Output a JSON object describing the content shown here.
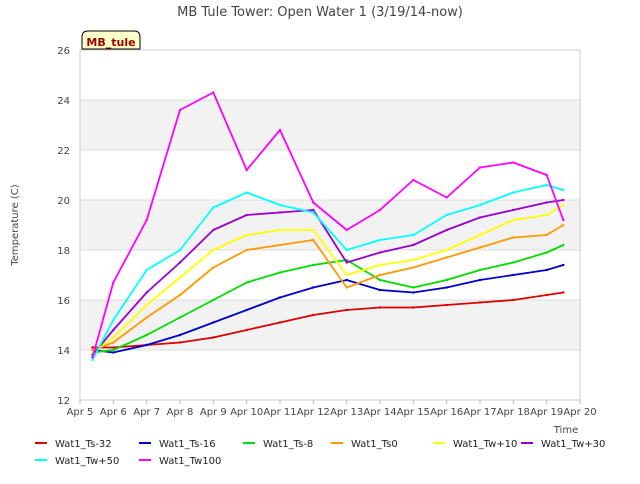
{
  "chart_data": {
    "type": "line",
    "title": "MB Tule Tower: Open Water 1 (3/19/14-now)",
    "xlabel": "Time",
    "ylabel": "Temperature (C)",
    "station_tag": "MB_tule",
    "ylim": [
      12,
      26
    ],
    "xlim": [
      "2014-04-05",
      "2014-04-20"
    ],
    "yticks": [
      "12",
      "14",
      "16",
      "18",
      "20",
      "22",
      "24",
      "26"
    ],
    "xticks": [
      "Apr 5",
      "Apr 6",
      "Apr 7",
      "Apr 8",
      "Apr 9",
      "Apr 10",
      "Apr 11",
      "Apr 12",
      "Apr 13",
      "Apr 14",
      "Apr 15",
      "Apr 16",
      "Apr 17",
      "Apr 18",
      "Apr 19",
      "Apr 20"
    ],
    "grid": true,
    "legend_position": "bottom",
    "x": [
      "2014-04-05 09:00",
      "2014-04-06 00:00",
      "2014-04-07 00:00",
      "2014-04-08 00:00",
      "2014-04-09 00:00",
      "2014-04-10 00:00",
      "2014-04-11 00:00",
      "2014-04-12 00:00",
      "2014-04-13 00:00",
      "2014-04-14 00:00",
      "2014-04-15 00:00",
      "2014-04-16 00:00",
      "2014-04-17 00:00",
      "2014-04-18 00:00",
      "2014-04-19 00:00",
      "2014-04-19 12:00"
    ],
    "series": [
      {
        "name": "Wat1_Ts-32",
        "color": "#dd0000",
        "values": [
          14.1,
          14.1,
          14.2,
          14.3,
          14.5,
          14.8,
          15.1,
          15.4,
          15.6,
          15.7,
          15.7,
          15.8,
          15.9,
          16.0,
          16.2,
          16.3
        ]
      },
      {
        "name": "Wat1_Ts-16",
        "color": "#0000cc",
        "values": [
          14.0,
          13.9,
          14.2,
          14.6,
          15.1,
          15.6,
          16.1,
          16.5,
          16.8,
          16.4,
          16.3,
          16.5,
          16.8,
          17.0,
          17.2,
          17.4
        ]
      },
      {
        "name": "Wat1_Ts-8",
        "color": "#00dd00",
        "values": [
          13.9,
          14.0,
          14.6,
          15.3,
          16.0,
          16.7,
          17.1,
          17.4,
          17.6,
          16.8,
          16.5,
          16.8,
          17.2,
          17.5,
          17.9,
          18.2
        ]
      },
      {
        "name": "Wat1_Ts0",
        "color": "#ff9900",
        "values": [
          14.0,
          14.3,
          15.3,
          16.2,
          17.3,
          18.0,
          18.2,
          18.4,
          16.5,
          17.0,
          17.3,
          17.7,
          18.1,
          18.5,
          18.6,
          19.0
        ]
      },
      {
        "name": "Wat1_Tw+10",
        "color": "#ffff00",
        "values": [
          13.9,
          14.5,
          15.8,
          16.9,
          18.0,
          18.6,
          18.8,
          18.8,
          17.0,
          17.4,
          17.6,
          18.0,
          18.6,
          19.2,
          19.4,
          19.8
        ]
      },
      {
        "name": "Wat1_Tw+30",
        "color": "#9900cc",
        "values": [
          13.8,
          14.8,
          16.3,
          17.5,
          18.8,
          19.4,
          19.5,
          19.6,
          17.5,
          17.9,
          18.2,
          18.8,
          19.3,
          19.6,
          19.9,
          20.0
        ]
      },
      {
        "name": "Wat1_Tw+50",
        "color": "#00ffff",
        "values": [
          13.6,
          15.2,
          17.2,
          18.0,
          19.7,
          20.3,
          19.8,
          19.5,
          18.0,
          18.4,
          18.6,
          19.4,
          19.8,
          20.3,
          20.6,
          20.4
        ]
      },
      {
        "name": "Wat1_Tw100",
        "color": "#ff00ff",
        "values": [
          13.7,
          16.7,
          19.2,
          23.6,
          24.3,
          21.2,
          22.8,
          19.9,
          18.8,
          19.6,
          20.8,
          20.1,
          21.3,
          21.5,
          21.0,
          19.2
        ]
      }
    ]
  }
}
